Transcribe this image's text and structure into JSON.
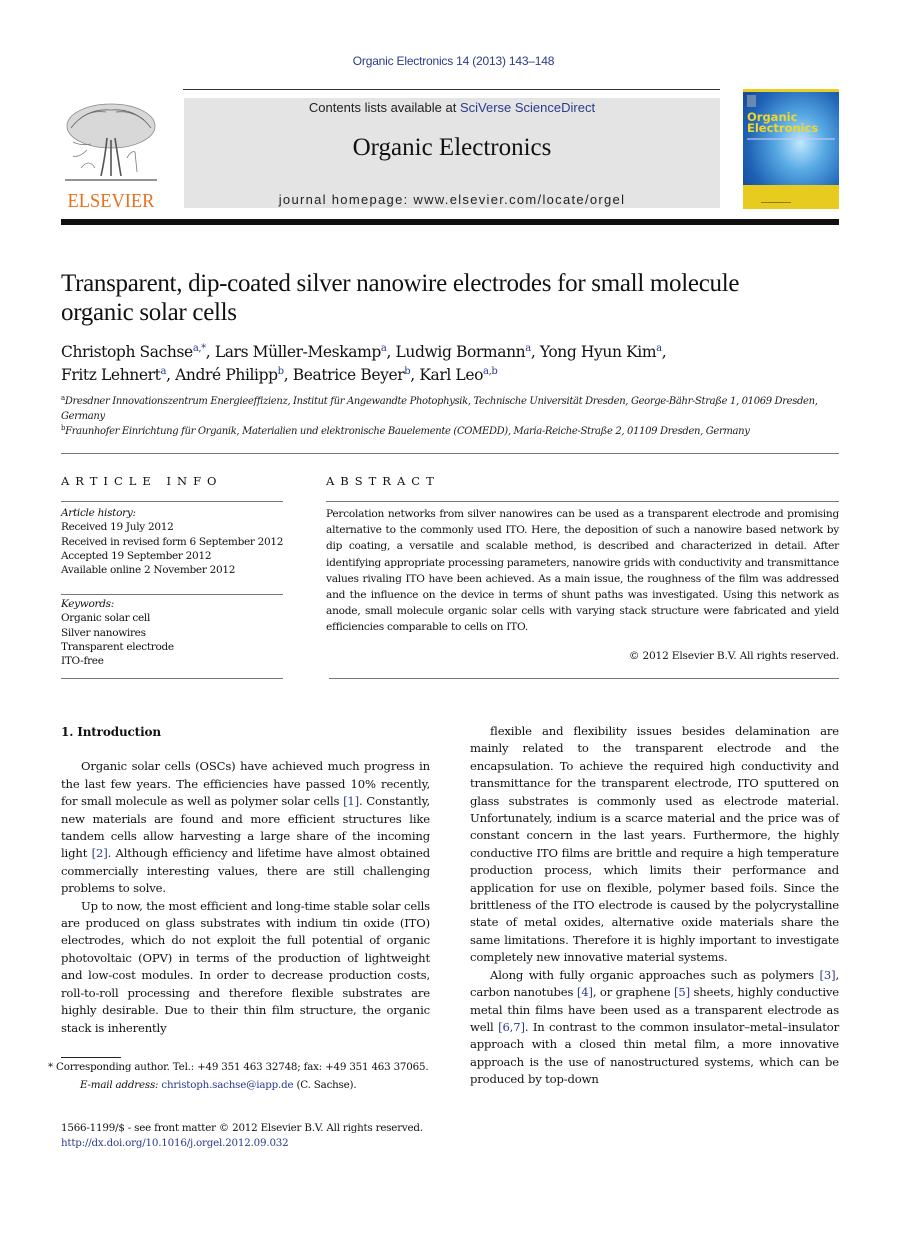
{
  "header": {
    "citation": "Organic Electronics 14 (2013) 143–148",
    "publisher_logo_text": "ELSEVIER",
    "contents_prefix": "Contents lists available at ",
    "contents_link": "SciVerse ScienceDirect",
    "journal_title": "Organic Electronics",
    "homepage": "journal homepage: www.elsevier.com/locate/orgel",
    "cover": {
      "title_line1": "Organic",
      "title_line2": "Electronics"
    }
  },
  "colors": {
    "link": "#2b3a8a",
    "elsevier_orange": "#e9711c",
    "banner_bg": "#e4e4e4",
    "cover_yellow": "#e8cf23"
  },
  "article": {
    "title": "Transparent, dip-coated silver nanowire electrodes for small molecule organic solar cells",
    "authors": [
      {
        "name": "Christoph Sachse",
        "aff": "a,*",
        "sep": ", "
      },
      {
        "name": "Lars Müller-Meskamp",
        "aff": "a",
        "sep": ", "
      },
      {
        "name": "Ludwig Bormann",
        "aff": "a",
        "sep": ", "
      },
      {
        "name": "Yong Hyun Kim",
        "aff": "a",
        "sep": ","
      },
      {
        "name": "Fritz Lehnert",
        "aff": "a",
        "sep": ", "
      },
      {
        "name": "André Philipp",
        "aff": "b",
        "sep": ", "
      },
      {
        "name": "Beatrice Beyer",
        "aff": "b",
        "sep": ", "
      },
      {
        "name": "Karl Leo",
        "aff": "a,b",
        "sep": ""
      }
    ],
    "affiliations": [
      {
        "mark": "a",
        "text": "Dresdner Innovationszentrum Energieeffizienz, Institut für Angewandte Photophysik, Technische Universität Dresden, George-Bähr-Straße 1, 01069 Dresden, Germany"
      },
      {
        "mark": "b",
        "text": "Fraunhofer Einrichtung für Organik, Materialien und elektronische Bauelemente (COMEDD), Maria-Reiche-Straße 2, 01109 Dresden, Germany"
      }
    ]
  },
  "article_info": {
    "heading": "ARTICLE INFO",
    "history_label": "Article history:",
    "history": [
      "Received 19 July 2012",
      "Received in revised form 6 September 2012",
      "Accepted 19 September 2012",
      "Available online 2 November 2012"
    ],
    "keywords_label": "Keywords:",
    "keywords": [
      "Organic solar cell",
      "Silver nanowires",
      "Transparent electrode",
      "ITO-free"
    ]
  },
  "abstract": {
    "heading": "ABSTRACT",
    "text": "Percolation networks from silver nanowires can be used as a transparent electrode and promising alternative to the commonly used ITO. Here, the deposition of such a nanowire based network by dip coating, a versatile and scalable method, is described and characterized in detail. After identifying appropriate processing parameters, nanowire grids with conductivity and transmittance values rivaling ITO have been achieved. As a main issue, the roughness of the film was addressed and the influence on the device in terms of shunt paths was investigated. Using this network as anode, small molecule organic solar cells with varying stack structure were fabricated and yield efficiencies comparable to cells on ITO.",
    "copyright": "© 2012 Elsevier B.V. All rights reserved."
  },
  "body": {
    "section_title": "1. Introduction",
    "left_paragraphs": [
      [
        {
          "t": "Organic solar cells (OSCs) have achieved much progress in the last few years. The efficiencies have passed 10% recently, for small molecule as well as polymer solar cells "
        },
        {
          "ref": "[1]"
        },
        {
          "t": ". Constantly, new materials are found and more efficient structures like tandem cells allow harvesting a large share of the incoming light "
        },
        {
          "ref": "[2]"
        },
        {
          "t": ". Although efficiency and lifetime have almost obtained commercially interesting values, there are still challenging problems to solve."
        }
      ],
      [
        {
          "t": "Up to now, the most efficient and long-time stable solar cells are produced on glass substrates with indium tin oxide (ITO) electrodes, which do not exploit the full potential of organic photovoltaic (OPV) in terms of the production of lightweight and low-cost modules. In order to decrease production costs, roll-to-roll processing and therefore flexible substrates are highly desirable. Due to their thin film structure, the organic stack is inherently"
        }
      ]
    ],
    "right_paragraphs": [
      [
        {
          "t": "flexible and flexibility issues besides delamination are mainly related to the transparent electrode and the encapsulation. To achieve the required high conductivity and transmittance for the transparent electrode, ITO sputtered on glass substrates is commonly used as electrode material. Unfortunately, indium is a scarce material and the price was of constant concern in the last years. Furthermore, the highly conductive ITO films are brittle and require a high temperature production process, which limits their performance and application for use on flexible, polymer based foils. Since the brittleness of the ITO electrode is caused by the polycrystalline state of metal oxides, alternative oxide materials share the same limitations. Therefore it is highly important to investigate completely new innovative material systems."
        }
      ],
      [
        {
          "t": "Along with fully organic approaches such as polymers "
        },
        {
          "ref": "[3]"
        },
        {
          "t": ", carbon nanotubes "
        },
        {
          "ref": "[4]"
        },
        {
          "t": ", or graphene "
        },
        {
          "ref": "[5]"
        },
        {
          "t": " sheets, highly conductive metal thin films have been used as a transparent electrode as well "
        },
        {
          "ref": "[6,7]"
        },
        {
          "t": ". In contrast to the common insulator–metal–insulator approach with a closed thin metal film, a more innovative approach is the use of nanostructured systems, which can be produced by top-down"
        }
      ]
    ]
  },
  "footnotes": {
    "corresponding": "* Corresponding author. Tel.: +49 351 463 32748; fax: +49 351 463 37065.",
    "email_label": "E-mail address: ",
    "email": "christoph.sachse@iapp.de",
    "email_suffix": " (C. Sachse).",
    "issn": "1566-1199/$ - see front matter © 2012 Elsevier B.V. All rights reserved.",
    "doi": "http://dx.doi.org/10.1016/j.orgel.2012.09.032"
  }
}
